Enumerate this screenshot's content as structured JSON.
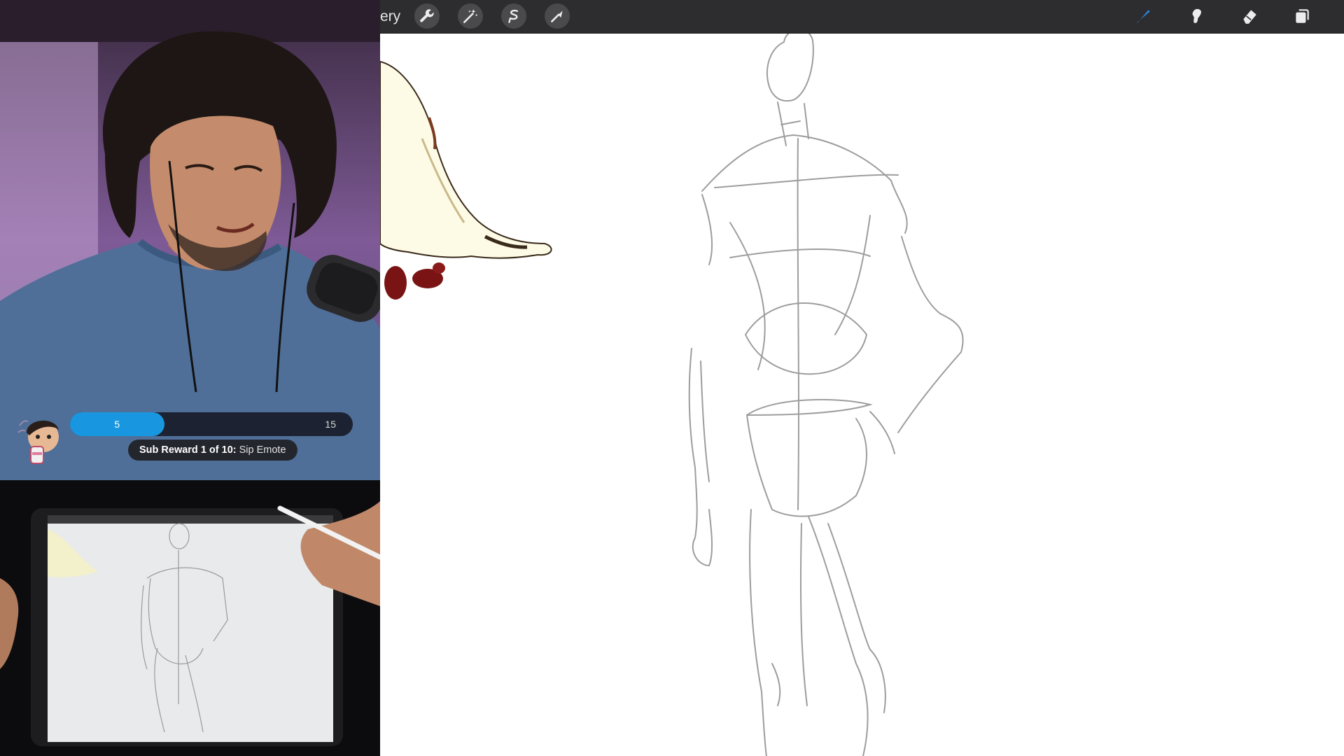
{
  "toolbar": {
    "gallery_label": "ery",
    "left_icons": [
      "wrench-icon",
      "magic-wand-icon",
      "selection-icon",
      "transform-arrow-icon"
    ],
    "right_icons": [
      "brush-icon",
      "smudge-icon",
      "eraser-icon",
      "layers-icon"
    ],
    "active_tool": "brush-icon",
    "accent_color": "#2a86e6"
  },
  "sub_goal": {
    "current": "5",
    "target": "15",
    "progress_fraction": 0.3333,
    "fill_color": "#1897e0",
    "reward_prefix": "Sub Reward 1 of 10:",
    "reward_name": "Sip Emote"
  }
}
